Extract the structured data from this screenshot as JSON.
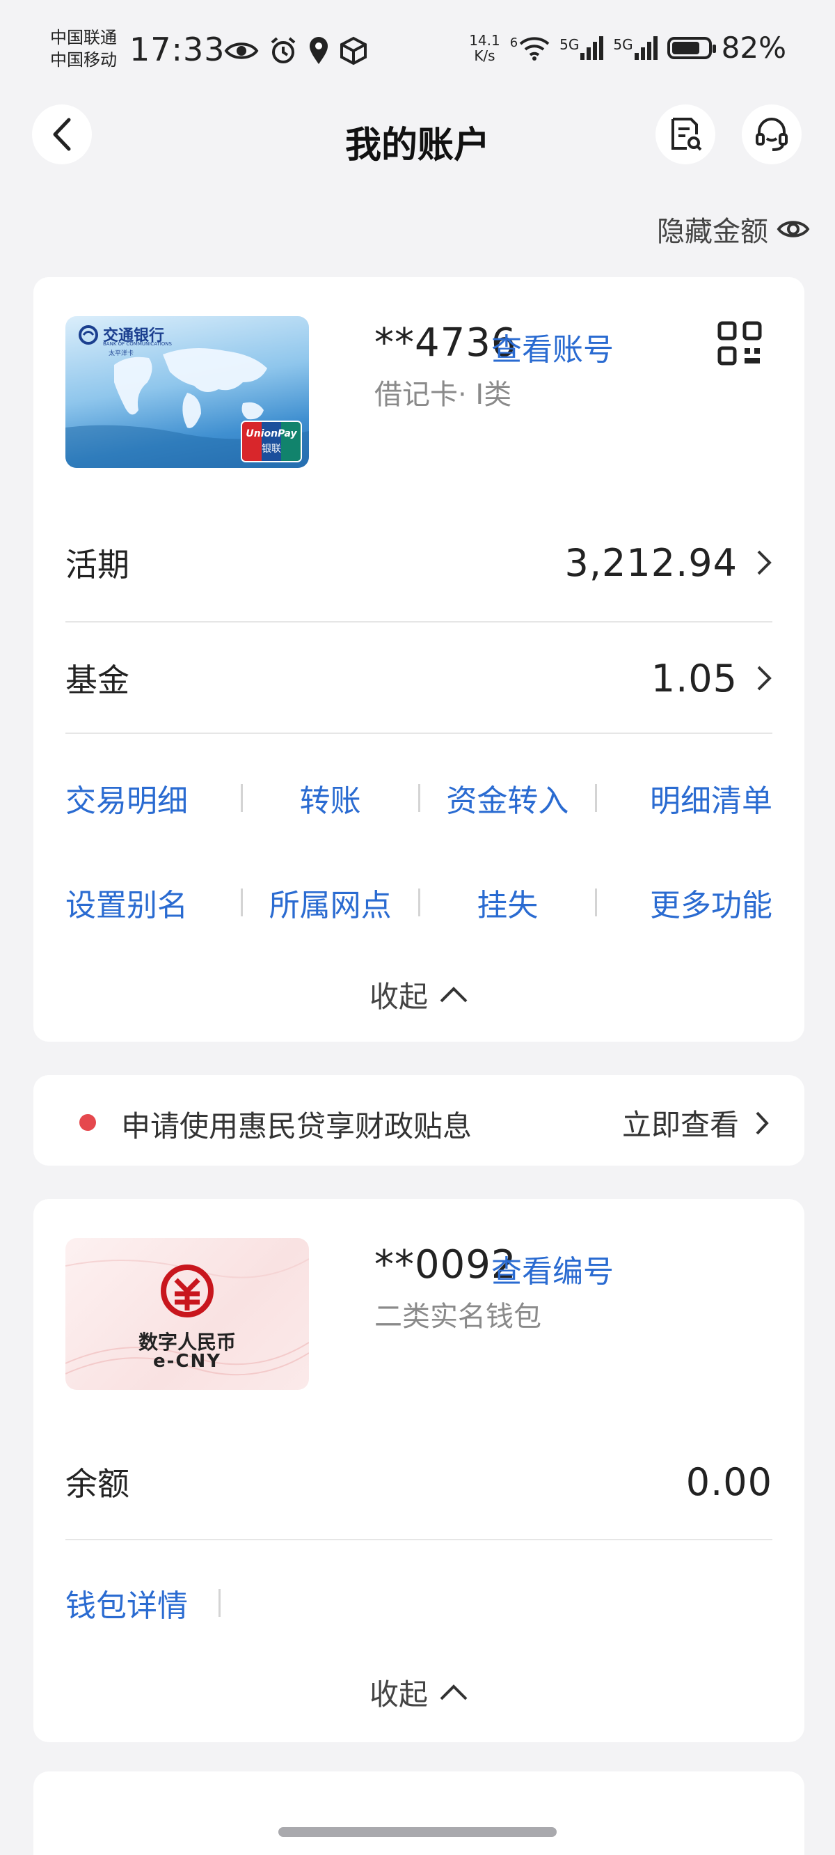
{
  "status_bar": {
    "carrier1": "中国联通",
    "carrier2": "中国移动",
    "time": "17:33",
    "net_speed_value": "14.1",
    "net_speed_unit": "K/s",
    "wifi_badge": "6",
    "sim1_label": "5G",
    "sim2_label": "5G",
    "battery_percent": "82%",
    "battery_level": 0.82
  },
  "header": {
    "title": "我的账户"
  },
  "hide_amount": {
    "label": "隐藏金额"
  },
  "debit_card": {
    "account_number": "**4736",
    "view_link": "查看账号",
    "type": "借记卡· I类",
    "card_image": {
      "bank_name": "交通银行",
      "bank_name_en": "BANK OF COMMUNICATIONS",
      "sub_label": "太平洋卡",
      "unionpay_en": "UnionPay",
      "unionpay_cn": "银联"
    },
    "rows": [
      {
        "label": "活期",
        "value": "3,212.94"
      },
      {
        "label": "基金",
        "value": "1.05"
      }
    ],
    "actions_row1": [
      "交易明细",
      "转账",
      "资金转入",
      "明细清单"
    ],
    "actions_row2": [
      "设置别名",
      "所属网点",
      "挂失",
      "更多功能"
    ],
    "collapse_label": "收起"
  },
  "promo": {
    "text": "申请使用惠民贷享财政贴息",
    "link": "立即查看"
  },
  "ecny_wallet": {
    "account_number": "**0092",
    "view_link": "查看编号",
    "type": "二类实名钱包",
    "card_image": {
      "title_cn": "数字人民币",
      "title_en": "e-CNY"
    },
    "rows": [
      {
        "label": "余额",
        "value": "0.00"
      }
    ],
    "actions": [
      "钱包详情"
    ],
    "collapse_label": "收起"
  },
  "colors": {
    "accent": "#2a6bd1",
    "background": "#f3f3f5",
    "promo_dot": "#e5484d"
  }
}
